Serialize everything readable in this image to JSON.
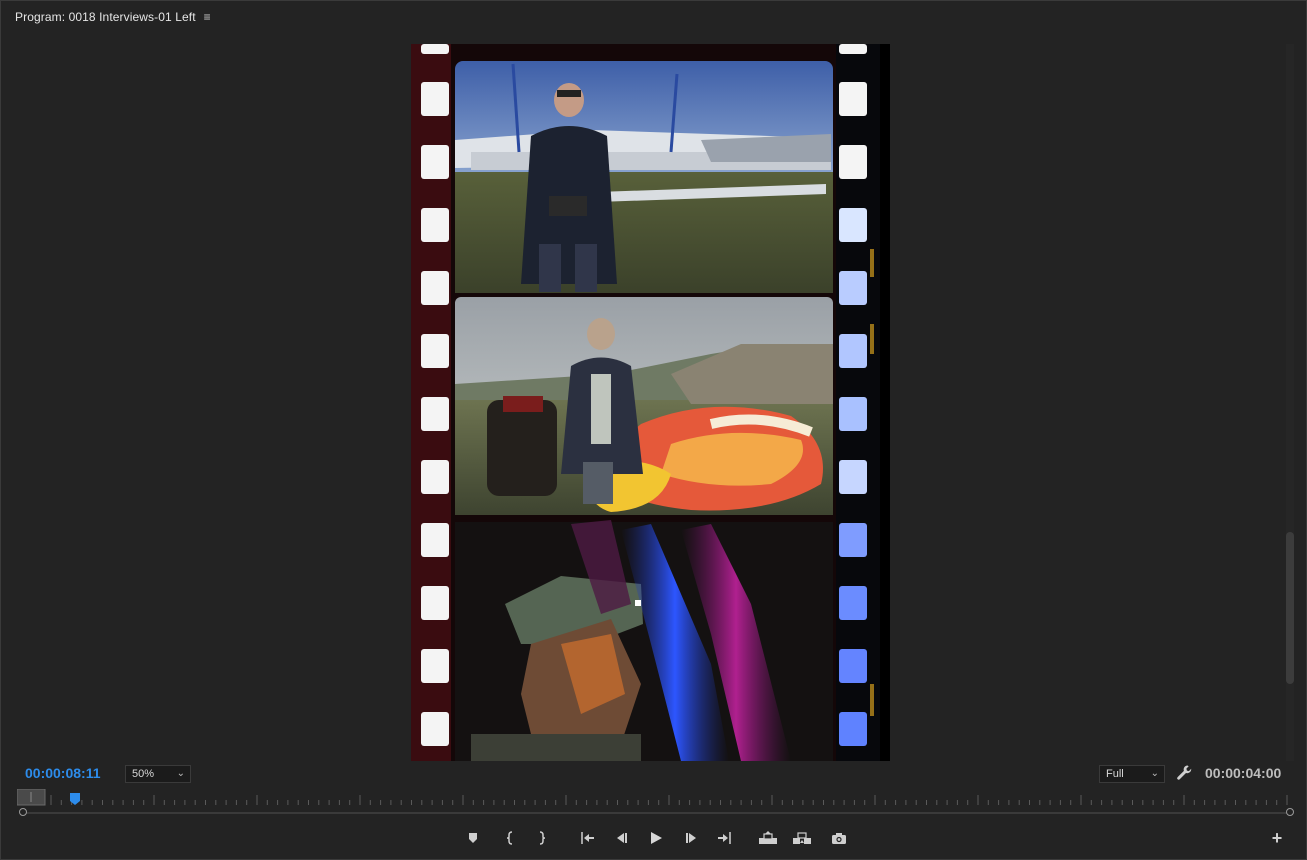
{
  "panel": {
    "title": "Program: 0018 Interviews-01 Left",
    "menu_icon": "hamburger-menu-icon"
  },
  "controls": {
    "current_timecode": "00:00:08:11",
    "zoom_level": "50%",
    "resolution": "Full",
    "duration_timecode": "00:00:04:00",
    "settings_icon": "wrench-icon"
  },
  "colors": {
    "accent": "#2d8ceb",
    "background": "#232323",
    "icon": "#cfcfcf"
  },
  "transport": [
    {
      "name": "add-marker-button",
      "icon": "marker-icon"
    },
    {
      "name": "mark-in-button",
      "icon": "mark-in-icon"
    },
    {
      "name": "mark-out-button",
      "icon": "mark-out-icon"
    },
    {
      "name": "go-to-in-button",
      "icon": "go-to-in-icon"
    },
    {
      "name": "step-back-button",
      "icon": "step-back-icon"
    },
    {
      "name": "play-button",
      "icon": "play-icon"
    },
    {
      "name": "step-forward-button",
      "icon": "step-forward-icon"
    },
    {
      "name": "go-to-out-button",
      "icon": "go-to-out-icon"
    },
    {
      "name": "lift-button",
      "icon": "lift-icon"
    },
    {
      "name": "extract-button",
      "icon": "extract-icon"
    },
    {
      "name": "export-frame-button",
      "icon": "camera-icon"
    }
  ],
  "button_editor_icon": "plus-icon"
}
